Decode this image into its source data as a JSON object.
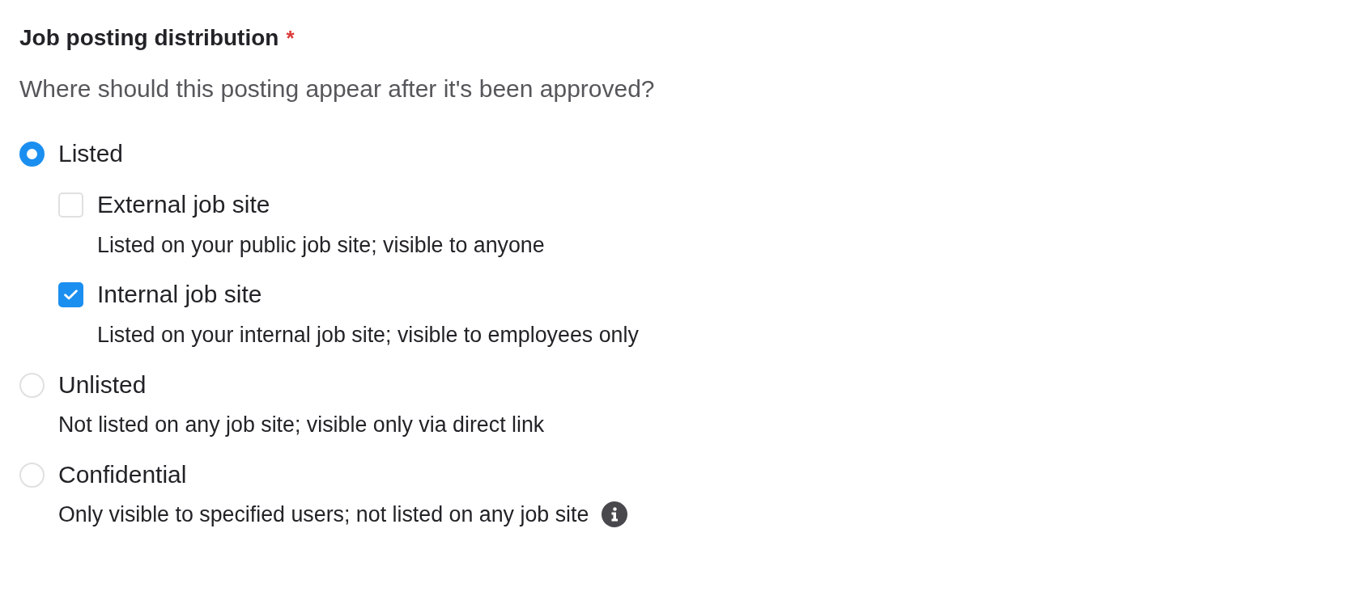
{
  "field": {
    "label": "Job posting distribution",
    "required_mark": "*",
    "help_text": "Where should this posting appear after it's been approved?"
  },
  "options": [
    {
      "label": "Listed",
      "selected": true,
      "children": [
        {
          "label": "External job site",
          "checked": false,
          "description": "Listed on your public job site; visible to anyone"
        },
        {
          "label": "Internal job site",
          "checked": true,
          "description": "Listed on your internal job site; visible to employees only"
        }
      ]
    },
    {
      "label": "Unlisted",
      "selected": false,
      "description": "Not listed on any job site; visible only via direct link"
    },
    {
      "label": "Confidential",
      "selected": false,
      "description": "Only visible to specified users; not listed on any job site",
      "info_icon": true
    }
  ]
}
